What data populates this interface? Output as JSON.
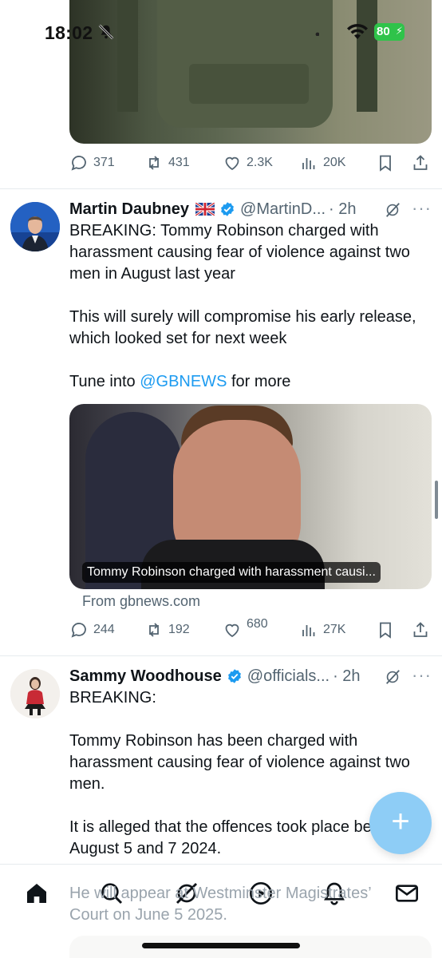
{
  "status_bar": {
    "time": "18:02",
    "battery": "80"
  },
  "tweet1": {
    "actions": {
      "replies": "371",
      "reposts": "431",
      "likes": "2.3K",
      "views": "20K"
    }
  },
  "tweet2": {
    "name": "Martin Daubney",
    "handle": "@MartinD...",
    "time": "· 2h",
    "text": "BREAKING: Tommy Robinson charged with harassment causing fear of violence against two men in August last year\n\nThis will surely will compromise his early release, which looked set for next week\n\nTune into ",
    "mention": "@GBNEWS",
    "text_tail": " for more",
    "card_caption": "Tommy Robinson charged with harassment causi...",
    "card_source": "From gbnews.com",
    "actions": {
      "replies": "244",
      "reposts": "192",
      "likes": "680",
      "views": "27K"
    }
  },
  "tweet3": {
    "name": "Sammy Woodhouse",
    "handle": "@officials...",
    "time": "· 2h",
    "text": "BREAKING:\n\nTommy Robinson has been charged with harassment causing fear of violence against two men.\n\nIt is alleged that the offences took place between August 5 and 7 2024.",
    "text_under_nav": "He will appear at Westminster Magistrates’\nCourt on June 5 2025."
  },
  "colors": {
    "accent": "#1d9bf0",
    "fab": "#8ecdf6",
    "muted": "#536471",
    "battery": "#2fc34a"
  },
  "icons": [
    "home-icon",
    "search-icon",
    "grok-icon",
    "play-icon",
    "notifications-icon",
    "mail-icon"
  ]
}
